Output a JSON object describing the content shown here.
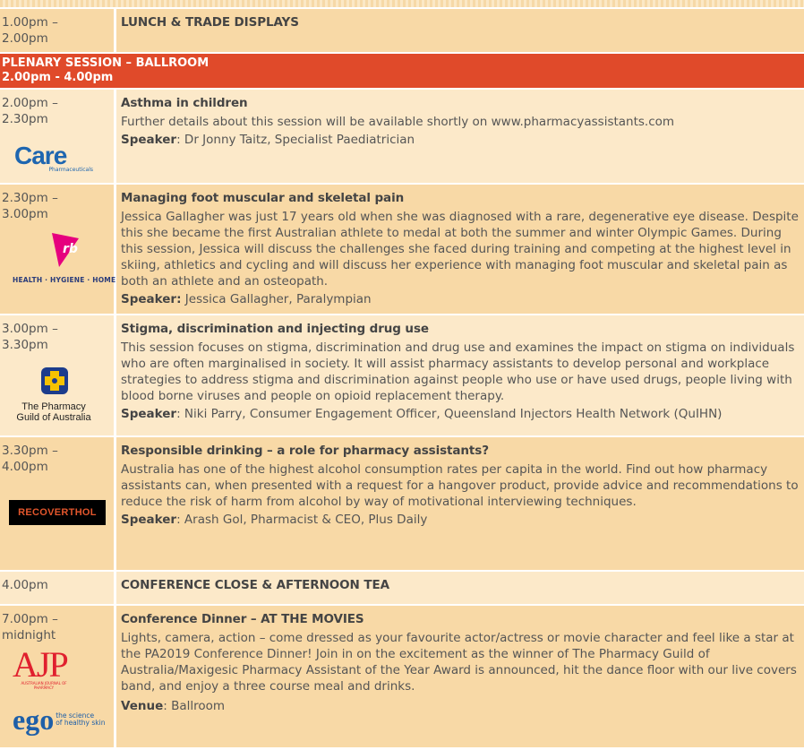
{
  "rows": [
    {
      "time": "1.00pm –\n2.00pm",
      "title": "LUNCH & TRADE DISPLAYS"
    },
    {
      "time": "2.00pm –\n2.30pm",
      "title": "Asthma in children",
      "desc": "Further details about this session will be available shortly on www.pharmacyassistants.com",
      "speaker_label": "Speaker",
      "speaker": ": Dr Jonny Taitz, Specialist Paediatrician"
    },
    {
      "time": "2.30pm –\n3.00pm",
      "title": "Managing foot muscular and skeletal pain",
      "desc": "Jessica Gallagher was just 17 years old when she was diagnosed with a rare, degenerative eye disease. Despite this she became the first Australian athlete to medal at both the summer and winter Olympic Games. During this session, Jessica will discuss the challenges she faced during training and competing at the highest level in skiing, athletics and cycling and will discuss her experience with managing foot muscular and skeletal pain as both an athlete and an osteopath.",
      "speaker_label": "Speaker:",
      "speaker": " Jessica Gallagher, Paralympian"
    },
    {
      "time": "3.00pm –\n3.30pm",
      "title": "Stigma, discrimination and injecting drug use",
      "desc": "This session focuses on stigma, discrimination and drug use and examines the impact on stigma on individuals who are often marginalised in society. It will assist pharmacy assistants to develop personal and workplace strategies to address stigma and discrimination against people who use or have used drugs, people living with blood borne viruses and people on opioid replacement therapy.",
      "speaker_label": "Speaker",
      "speaker": ": Niki Parry, Consumer Engagement Officer, Queensland Injectors Health Network (QuIHN)"
    },
    {
      "time": "3.30pm –\n4.00pm",
      "title": "Responsible drinking – a role for pharmacy assistants?",
      "desc": "Australia has one of the highest alcohol consumption rates per capita in the world. Find out how pharmacy assistants can, when presented with a request for a hangover product, provide advice and recommendations to reduce the risk of harm from alcohol by way of motivational interviewing techniques.",
      "speaker_label": "Speaker",
      "speaker": ": Arash Gol, Pharmacist & CEO, Plus Daily"
    },
    {
      "time": "4.00pm",
      "title": "CONFERENCE CLOSE & AFTERNOON TEA"
    },
    {
      "time": "7.00pm –\nmidnight",
      "title": "Conference Dinner – AT THE MOVIES",
      "desc": "Lights, camera, action – come dressed as your favourite actor/actress or movie character and feel like a star at the PA2019 Conference Dinner! Join in on the excitement as the winner of The Pharmacy Guild of Australia/Maxigesic Pharmacy Assistant of the Year Award is announced, hit the dance floor with our live covers band, and enjoy a three course meal and drinks.",
      "speaker_label": "Venue",
      "speaker": ": Ballroom"
    }
  ],
  "plenary": {
    "line1": "PLENARY SESSION – BALLROOM",
    "line2": "2.00pm - 4.00pm"
  },
  "logos": {
    "care": {
      "word": "Care",
      "sub": "Pharmaceuticals"
    },
    "rb": {
      "mark": "rb",
      "text": "HEALTH · HYGIENE · HOME"
    },
    "guild": {
      "text": "The Pharmacy\nGuild of Australia"
    },
    "recov": {
      "text": "RECOVERTHOL"
    },
    "ajp": {
      "word": "AJP",
      "sub": "AUSTRALIAN JOURNAL OF PHARMACY"
    },
    "ego": {
      "word": "ego",
      "sub": "the science\nof healthy skin"
    }
  },
  "colors": {
    "plenary": "#e04a2a",
    "row_light": "#fce9c9",
    "row_dark": "#f8d9a6"
  }
}
